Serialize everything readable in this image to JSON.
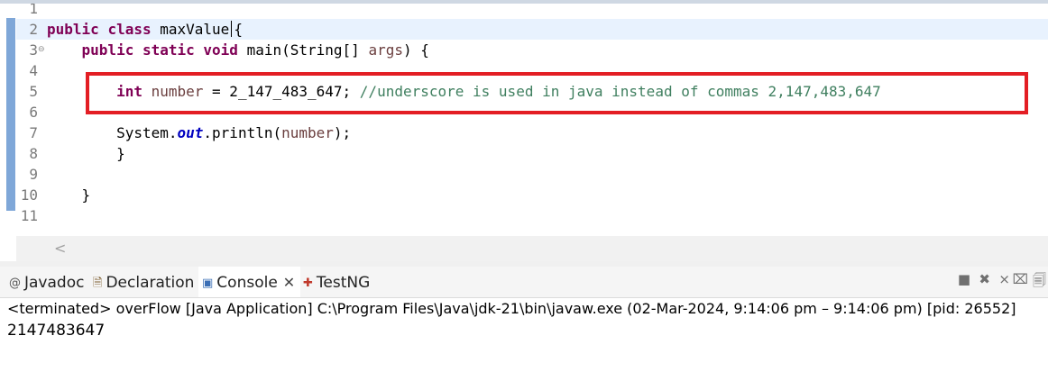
{
  "editor": {
    "line_numbers": [
      "1",
      "2",
      "3",
      "4",
      "5",
      "6",
      "7",
      "8",
      "9",
      "10",
      "11"
    ],
    "line2": {
      "kw1": "public",
      "kw2": "class",
      "class_name": "maxValue",
      "brace": "{"
    },
    "line3": {
      "kw1": "public",
      "kw2": "static",
      "kw3": "void",
      "method": "main(String[]",
      "param": "args",
      "rest": ") {"
    },
    "line5": {
      "type": "int",
      "var": "number",
      "assign": " = 2_147_483_647; ",
      "comment": "//underscore is used in java instead of commas 2,147,483,647"
    },
    "line7": {
      "prefix": "System.",
      "field": "out",
      "call": ".println(",
      "arg": "number",
      "end": ");"
    },
    "line8": "}",
    "line10": "}"
  },
  "console_panel": {
    "tabs": [
      {
        "label": "Javadoc",
        "icon": "at-icon"
      },
      {
        "label": "Declaration",
        "icon": "declaration-icon"
      },
      {
        "label": "Console",
        "icon": "console-icon",
        "active": true
      },
      {
        "label": "TestNG",
        "icon": "testng-icon"
      }
    ],
    "status_line": "<terminated> overFlow [Java Application] C:\\Program Files\\Java\\jdk-21\\bin\\javaw.exe  (02-Mar-2024, 9:14:06 pm – 9:14:06 pm) [pid: 26552]",
    "output": "2147483647"
  },
  "colors": {
    "keyword": "#7f0055",
    "comment": "#3f7f5f",
    "field": "#0000c0",
    "highlight_box": "#e31e24"
  }
}
